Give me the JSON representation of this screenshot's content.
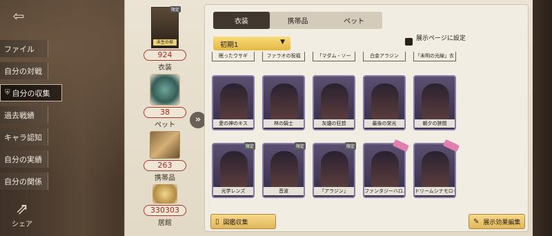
{
  "sidebar": {
    "exit_icon": "exit-door-icon",
    "items": [
      {
        "label": "ファイル",
        "active": false
      },
      {
        "label": "自分の対戦",
        "active": false
      },
      {
        "label": "自分の収集",
        "active": true
      },
      {
        "label": "過去戦績",
        "active": false
      },
      {
        "label": "キャラ認知",
        "active": false
      },
      {
        "label": "自分の実績",
        "active": false
      },
      {
        "label": "自分の関係",
        "active": false
      }
    ],
    "share_label": "シェア"
  },
  "stats": {
    "portrait_caption": "未生の探",
    "portrait_badge": "限定",
    "items": [
      {
        "value": "924",
        "label": "衣装"
      },
      {
        "value": "38",
        "label": "ペット"
      },
      {
        "value": "263",
        "label": "携帯品"
      },
      {
        "value": "330303",
        "label": "居館"
      }
    ]
  },
  "tabs": [
    "衣装",
    "携帯品",
    "ペット"
  ],
  "active_tab": "衣装",
  "dropdown": {
    "selected": "初期1"
  },
  "display_setting_label": "展示ページに設定",
  "prev_row_labels": [
    "眠ったウサギ",
    "ファラオの祝福",
    "「マダム・ソー",
    "白金アラジン",
    "「未明の光線」衣"
  ],
  "rows": [
    [
      {
        "name": "愛の神のキス",
        "badge": ""
      },
      {
        "name": "林の騎士",
        "badge": ""
      },
      {
        "name": "灰燼の狂想",
        "badge": ""
      },
      {
        "name": "最後の栄光",
        "badge": ""
      },
      {
        "name": "朝夕の狭間",
        "badge": ""
      }
    ],
    [
      {
        "name": "光学レンズ",
        "badge": "限定"
      },
      {
        "name": "音波",
        "badge": "限定"
      },
      {
        "name": "「アラジン」",
        "badge": "限定"
      },
      {
        "name": "ファンタジーハロ...",
        "badge": "ribbon"
      },
      {
        "name": "ドリームシナモロー",
        "badge": "ribbon"
      }
    ]
  ],
  "buttons": {
    "catalog": "図鑑収集",
    "edit_display": "展示効果編集"
  },
  "colors": {
    "stat_number": "#a32a1c",
    "dropdown": "#f0cc5e",
    "active_tab": "#403730"
  }
}
